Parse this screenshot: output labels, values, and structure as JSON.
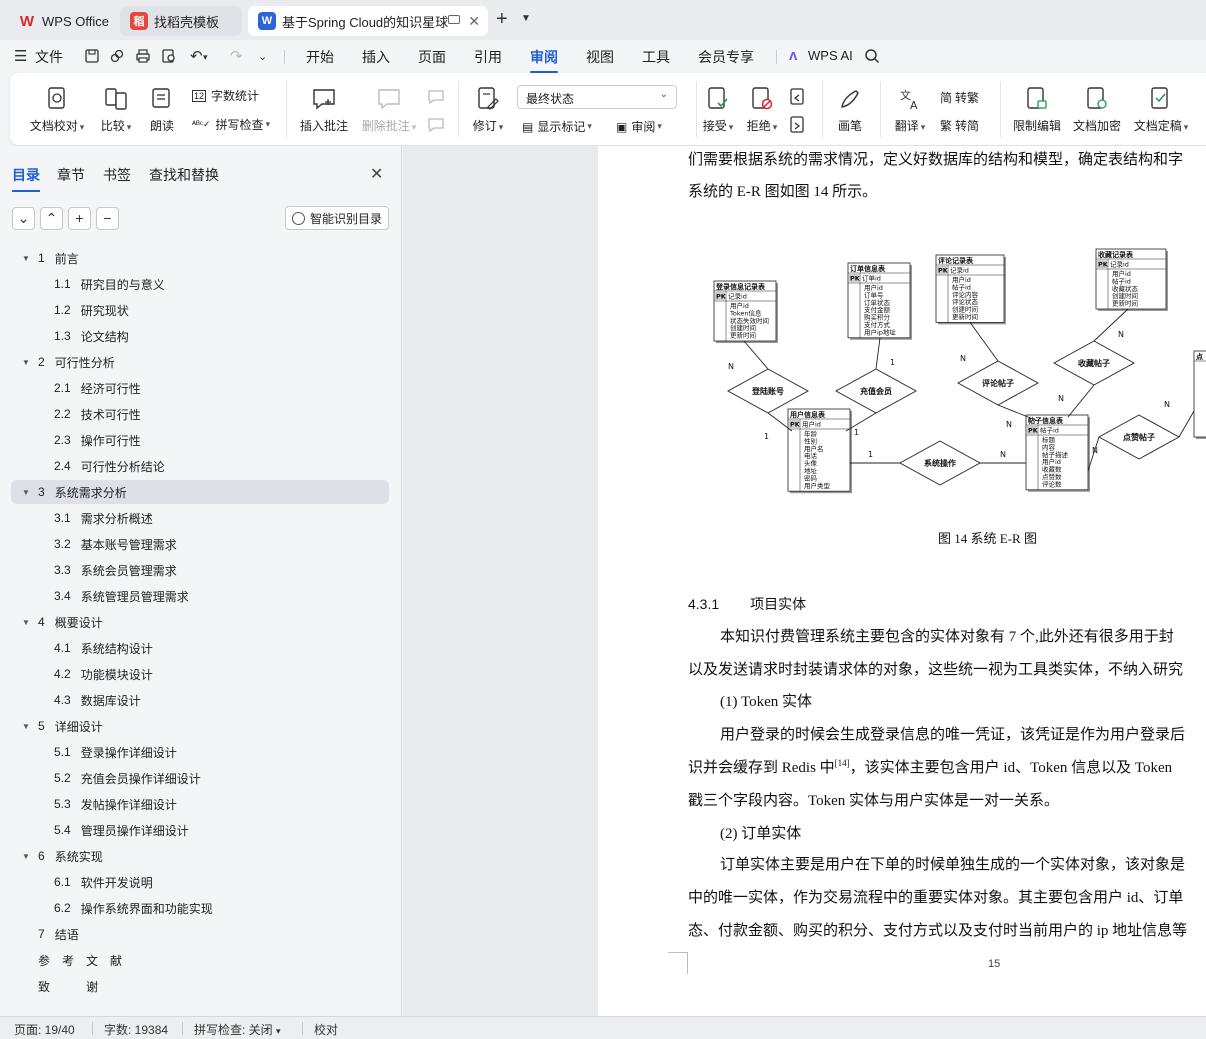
{
  "tabs": [
    {
      "label": "WPS Office",
      "icon": "wps-logo-icon",
      "active": false
    },
    {
      "label": "找稻壳模板",
      "icon": "daoke-icon",
      "active": false
    },
    {
      "label": "基于Spring Cloud的知识星球",
      "icon": "word-doc-icon",
      "active": true
    }
  ],
  "menu": {
    "file": "文件",
    "items": [
      "开始",
      "插入",
      "页面",
      "引用",
      "审阅",
      "视图",
      "工具",
      "会员专享"
    ],
    "active": "审阅",
    "wps_ai": "WPS AI"
  },
  "ribbon": {
    "doc_proof": "文档校对",
    "compare": "比较",
    "read_aloud": "朗读",
    "word_count": "字数统计",
    "spell_check": "拼写检查",
    "insert_comment": "插入批注",
    "delete_comment": "删除批注",
    "track_changes": "修订",
    "final_state": "最终状态",
    "show_markup": "显示标记",
    "review": "审阅",
    "accept": "接受",
    "reject": "拒绝",
    "pen": "画笔",
    "translate": "翻译",
    "to_traditional": "转繁",
    "to_simplified": "转简",
    "restrict_edit": "限制编辑",
    "encrypt": "文档加密",
    "finalize": "文档定稿"
  },
  "nav": {
    "tabs": [
      "目录",
      "章节",
      "书签",
      "查找和替换"
    ],
    "active": "目录",
    "smart_toc": "智能识别目录",
    "toc": [
      {
        "level": 1,
        "num": "1",
        "title": "前言",
        "expanded": true
      },
      {
        "level": 2,
        "num": "1.1",
        "title": "研究目的与意义"
      },
      {
        "level": 2,
        "num": "1.2",
        "title": "研究现状"
      },
      {
        "level": 2,
        "num": "1.3",
        "title": "论文结构"
      },
      {
        "level": 1,
        "num": "2",
        "title": "可行性分析",
        "expanded": true
      },
      {
        "level": 2,
        "num": "2.1",
        "title": "经济可行性"
      },
      {
        "level": 2,
        "num": "2.2",
        "title": "技术可行性"
      },
      {
        "level": 2,
        "num": "2.3",
        "title": "操作可行性"
      },
      {
        "level": 2,
        "num": "2.4",
        "title": "可行性分析结论"
      },
      {
        "level": 1,
        "num": "3",
        "title": "系统需求分析",
        "expanded": true,
        "selected": true
      },
      {
        "level": 2,
        "num": "3.1",
        "title": "需求分析概述"
      },
      {
        "level": 2,
        "num": "3.2",
        "title": "基本账号管理需求"
      },
      {
        "level": 2,
        "num": "3.3",
        "title": "系统会员管理需求"
      },
      {
        "level": 2,
        "num": "3.4",
        "title": "系统管理员管理需求"
      },
      {
        "level": 1,
        "num": "4",
        "title": "概要设计",
        "expanded": true
      },
      {
        "level": 2,
        "num": "4.1",
        "title": "系统结构设计"
      },
      {
        "level": 2,
        "num": "4.2",
        "title": "功能模块设计"
      },
      {
        "level": 2,
        "num": "4.3",
        "title": "数据库设计"
      },
      {
        "level": 1,
        "num": "5",
        "title": "详细设计",
        "expanded": true
      },
      {
        "level": 2,
        "num": "5.1",
        "title": "登录操作详细设计"
      },
      {
        "level": 2,
        "num": "5.2",
        "title": "充值会员操作详细设计"
      },
      {
        "level": 2,
        "num": "5.3",
        "title": "发帖操作详细设计"
      },
      {
        "level": 2,
        "num": "5.4",
        "title": "管理员操作详细设计"
      },
      {
        "level": 1,
        "num": "6",
        "title": "系统实现",
        "expanded": true
      },
      {
        "level": 2,
        "num": "6.1",
        "title": "软件开发说明"
      },
      {
        "level": 2,
        "num": "6.2",
        "title": "操作系统界面和功能实现"
      },
      {
        "level": 1,
        "num": "7",
        "title": "结语",
        "expanded": null
      },
      {
        "level": 0,
        "num": "",
        "title": "参　考　文　献"
      },
      {
        "level": 0,
        "num": "",
        "title": "致　　　谢"
      }
    ]
  },
  "doc": {
    "line1": "们需要根据系统的需求情况，定义好数据库的结构和模型，确定表结构和字",
    "line2": "系统的 E-R 图如图 14 所示。",
    "caption": "图 14  系统 E-R 图",
    "heading_num": "4.3.1",
    "heading_title": "项目实体",
    "p1a": "本知识付费管理系统主要包含的实体对象有 7 个,此外还有很多用于封",
    "p1b": "以及发送请求时封装请求体的对象，这些统一视为工具类实体，不纳入研究",
    "item1": "(1)    Token 实体",
    "p2a": "用户登录的时候会生成登录信息的唯一凭证，该凭证是作为用户登录后",
    "p2b_pre": "识并会缓存到 Redis 中",
    "p2b_ref": "[14]",
    "p2b_post": "，该实体主要包含用户 id、Token 信息以及 Token",
    "p2c": "戳三个字段内容。Token 实体与用户实体是一对一关系。",
    "item2": "(2)    订单实体",
    "p3a": "订单实体主要是用户在下单的时候单独生成的一个实体对象，该对象是",
    "p3b": "中的唯一实体，作为交易流程中的重要实体对象。其主要包含用户 id、订单",
    "p3c": "态、付款金额、购买的积分、支付方式以及支付时当前用户的 ip 地址信息等",
    "page_number": "15"
  },
  "erd": {
    "entities": [
      {
        "title": "登录信息记录表",
        "pk": "记录id",
        "fields": [
          "用户id",
          "Token信息",
          "状态失效时间",
          "创建时间",
          "更新时间"
        ]
      },
      {
        "title": "订单信息表",
        "pk": "订单id",
        "fields": [
          "用户id",
          "订单号",
          "订单状态",
          "支付金额",
          "购买积分",
          "支付方式",
          "用户ip地址"
        ]
      },
      {
        "title": "评论记录表",
        "pk": "记录id",
        "fields": [
          "用户id",
          "帖子id",
          "评论内容",
          "评论状态",
          "创建时间",
          "更新时间"
        ]
      },
      {
        "title": "收藏记录表",
        "pk": "记录id",
        "fields": [
          "用户id",
          "帖子id",
          "收藏状态",
          "创建时间",
          "更新时间"
        ]
      },
      {
        "title": "用户信息表",
        "pk": "用户id",
        "fields": [
          "年龄",
          "性别",
          "用户名",
          "电话",
          "头像",
          "地址",
          "密码",
          "用户类型"
        ]
      },
      {
        "title": "帖子信息表",
        "pk": "帖子id",
        "fields": [
          "标题",
          "内容",
          "帖子描述",
          "用户id",
          "收藏数",
          "点赞数",
          "评论数"
        ]
      },
      {
        "title": "点",
        "pk": "",
        "fields": []
      }
    ],
    "relations": [
      "登陆账号",
      "充值会员",
      "评论帖子",
      "收藏帖子",
      "系统操作",
      "点赞帖子"
    ],
    "pk_label": "PK",
    "card_1": "1",
    "card_n": "N"
  },
  "status": {
    "page": "页面: 19/40",
    "words": "字数: 19384",
    "spell": "拼写检查: 关闭",
    "proof": "校对"
  }
}
